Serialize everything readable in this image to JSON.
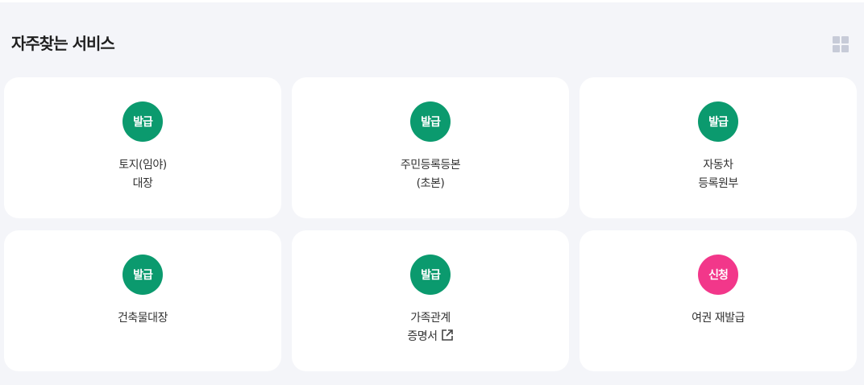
{
  "section": {
    "title": "자주찾는 서비스",
    "view_toggle_icon": "grid-view-icon"
  },
  "colors": {
    "issue_badge": "#0b9a6e",
    "apply_badge": "#f2378a"
  },
  "cards": [
    {
      "badge": "발급",
      "badge_type": "issue",
      "lines": [
        "토지(임야)",
        "대장"
      ]
    },
    {
      "badge": "발급",
      "badge_type": "issue",
      "lines": [
        "주민등록등본",
        "(초본)"
      ]
    },
    {
      "badge": "발급",
      "badge_type": "issue",
      "lines": [
        "자동차",
        "등록원부"
      ]
    },
    {
      "badge": "발급",
      "badge_type": "issue",
      "lines": [
        "건축물대장"
      ]
    },
    {
      "badge": "발급",
      "badge_type": "issue",
      "lines": [
        "가족관계",
        "증명서"
      ],
      "external_icon": "external-link-icon"
    },
    {
      "badge": "신청",
      "badge_type": "apply",
      "lines": [
        "여권 재발급"
      ]
    }
  ]
}
